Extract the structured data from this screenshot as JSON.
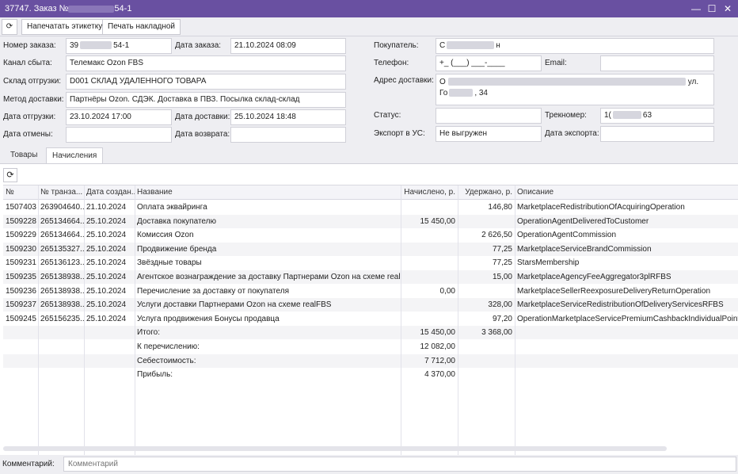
{
  "window": {
    "title": "37747. Заказ №",
    "title_tail": "54-1",
    "minimize_icon": "—",
    "maximize_icon": "☐",
    "close_icon": "✕"
  },
  "toolbar": {
    "refresh_icon": "⟳",
    "print_label": "Напечатать этикетку",
    "invoice_label": "Печать накладной"
  },
  "order": {
    "number_label": "Номер заказа:",
    "number_head": "39",
    "number_tail": "54-1",
    "date_label": "Дата заказа:",
    "date_value": "21.10.2024 08:09",
    "channel_label": "Канал сбыта:",
    "channel_value": "Телемакс Ozon FBS",
    "warehouse_label": "Склад отгрузки:",
    "warehouse_value": "D001 СКЛАД УДАЛЕННОГО ТОВАРА",
    "delivery_method_label": "Метод доставки:",
    "delivery_method_value": "Партнёры Ozon. СДЭК. Доставка в ПВЗ. Посылка склад-склад",
    "ship_date_label": "Дата отгрузки:",
    "ship_date_value": "23.10.2024 17:00",
    "delivery_date_label": "Дата доставки:",
    "delivery_date_value": "25.10.2024 18:48",
    "cancel_date_label": "Дата отмены:",
    "cancel_date_value": "",
    "return_date_label": "Дата возврата:",
    "return_date_value": ""
  },
  "customer": {
    "buyer_label": "Покупатель:",
    "buyer_head": "С",
    "buyer_tail": "н",
    "phone_label": "Телефон:",
    "phone_value": "+_ (___) ___-____",
    "email_label": "Email:",
    "email_value": "",
    "address_label": "Адрес доставки:",
    "address_head": "О",
    "address_tail": "ул.",
    "address_line2_head": "Го",
    "address_line2_tail": ", 34",
    "status_label": "Статус:",
    "status_value": "",
    "tracking_label": "Трекномер:",
    "tracking_head": "1(",
    "tracking_tail": "63",
    "export_label": "Экспорт в УС:",
    "export_value": "Не выгружен",
    "export_date_label": "Дата экспорта:",
    "export_date_value": ""
  },
  "tabs": [
    "Товары",
    "Начисления"
  ],
  "grid": {
    "refresh_icon": "⟳",
    "headers": [
      "№",
      "№ транза...",
      "Дата создан...",
      "Название",
      "Начислено, р.",
      "Удержано, р.",
      "Описание"
    ],
    "rows": [
      [
        "1507403",
        "263904640...",
        "21.10.2024",
        "Оплата эквайринга",
        "",
        "146,80",
        "MarketplaceRedistributionOfAcquiringOperation"
      ],
      [
        "1509228",
        "265134664...",
        "25.10.2024",
        "Доставка покупателю",
        "15 450,00",
        "",
        "OperationAgentDeliveredToCustomer"
      ],
      [
        "1509229",
        "265134664...",
        "25.10.2024",
        "Комиссия Ozon",
        "",
        "2 626,50",
        "OperationAgentCommission"
      ],
      [
        "1509230",
        "265135327...",
        "25.10.2024",
        "Продвижение бренда",
        "",
        "77,25",
        "MarketplaceServiceBrandCommission"
      ],
      [
        "1509231",
        "265136123...",
        "25.10.2024",
        "Звёздные товары",
        "",
        "77,25",
        "StarsMembership"
      ],
      [
        "1509235",
        "265138938...",
        "25.10.2024",
        "Агентское вознаграждение за доставку Партнерами Ozon на схеме realFBS",
        "",
        "15,00",
        "MarketplaceAgencyFeeAggregator3plRFBS"
      ],
      [
        "1509236",
        "265138938...",
        "25.10.2024",
        "Перечисление за доставку от покупателя",
        "0,00",
        "",
        "MarketplaceSellerReexposureDeliveryReturnOperation"
      ],
      [
        "1509237",
        "265138938...",
        "25.10.2024",
        "Услуги доставки Партнерами Ozon на схеме realFBS",
        "",
        "328,00",
        "MarketplaceServiceRedistributionOfDeliveryServicesRFBS"
      ],
      [
        "1509245",
        "265156235...",
        "25.10.2024",
        "Услуга продвижения Бонусы продавца",
        "",
        "97,20",
        "OperationMarketplaceServicePremiumCashbackIndividualPoints"
      ]
    ],
    "summary": [
      [
        "Итого:",
        "15 450,00",
        "3 368,00"
      ],
      [
        "К перечислению:",
        "12 082,00",
        ""
      ],
      [
        "Себестоимость:",
        "7 712,00",
        ""
      ],
      [
        "Прибыль:",
        "4 370,00",
        ""
      ]
    ]
  },
  "comment": {
    "label": "Комментарий:",
    "placeholder": "Комментарий"
  }
}
